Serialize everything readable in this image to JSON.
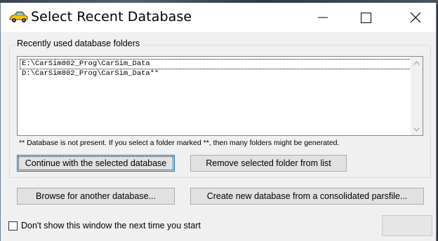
{
  "window": {
    "title": "Select Recent Database",
    "controls": {
      "minimize": "minimize-icon",
      "maximize": "maximize-icon",
      "close": "close-icon"
    }
  },
  "recent_group": {
    "legend": "Recently used database folders",
    "items": [
      {
        "path": "E:\\CarSim802_Prog\\CarSim_Data",
        "selected": true
      },
      {
        "path": "D:\\CarSim802_Prog\\CarSim_Data**",
        "selected": false
      }
    ],
    "note": "** Database is not present. If you select a folder marked **, then many folders might be generated."
  },
  "buttons": {
    "continue": "Continue with the selected database",
    "remove": "Remove selected folder from list",
    "browse": "Browse for another database...",
    "create": "Create new database from a consolidated parsfile..."
  },
  "footer": {
    "dont_show_label": "Don't show this window the next time you start",
    "dont_show_checked": false
  },
  "colors": {
    "focus_border": "#0078d7",
    "window_bg": "#f0f0f0"
  }
}
